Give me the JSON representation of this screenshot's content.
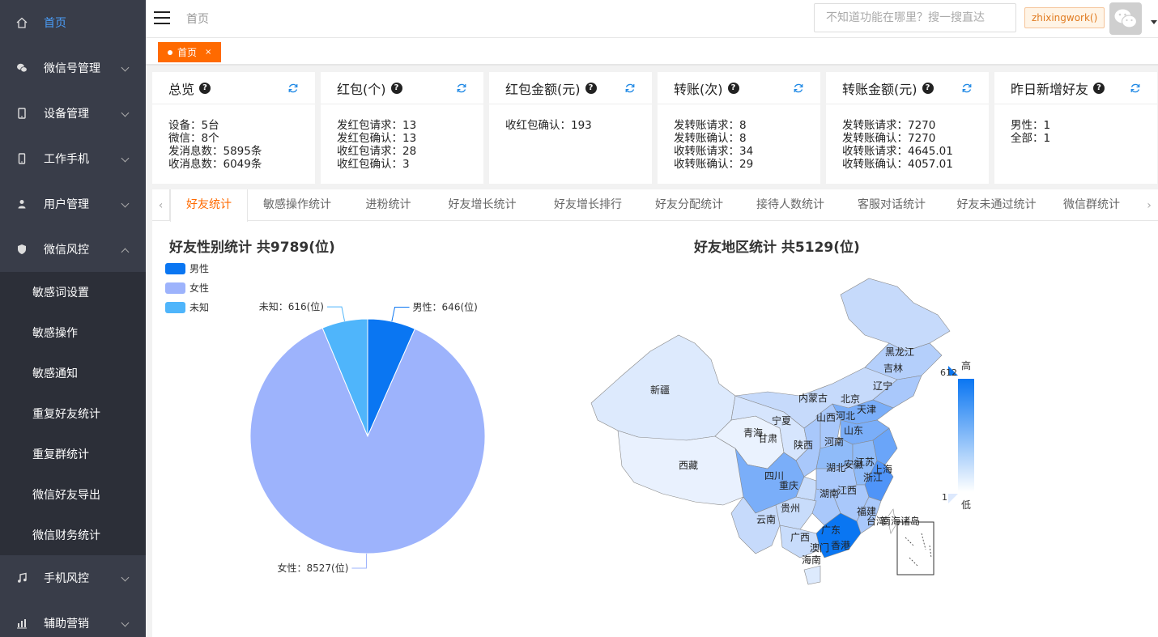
{
  "sidebar": {
    "items": [
      {
        "label": "首页",
        "icon": "home-icon"
      },
      {
        "label": "微信号管理",
        "icon": "wechat-icon"
      },
      {
        "label": "设备管理",
        "icon": "tablet-icon"
      },
      {
        "label": "工作手机",
        "icon": "phone-icon"
      },
      {
        "label": "用户管理",
        "icon": "user-icon"
      },
      {
        "label": "微信风控",
        "icon": "shield-icon"
      }
    ],
    "sub_items": [
      "敏感词设置",
      "敏感操作",
      "敏感通知",
      "重复好友统计",
      "重复群统计",
      "微信好友导出",
      "微信财务统计"
    ],
    "bottom_items": [
      {
        "label": "手机风控",
        "icon": "music-icon"
      },
      {
        "label": "辅助营销",
        "icon": "bar-chart-icon"
      }
    ]
  },
  "header": {
    "breadcrumb": "首页",
    "search_placeholder": "不知道功能在哪里？搜一搜直达",
    "username": "zhixingwork()"
  },
  "page_tab": {
    "label": "首页",
    "close": "×"
  },
  "cards": [
    {
      "title": "总览",
      "lines": [
        "设备：5台",
        "微信：8个",
        "发消息数：5895条",
        "收消息数：6049条"
      ]
    },
    {
      "title": "红包(个)",
      "lines": [
        "发红包请求：13",
        "发红包确认：13",
        "收红包请求：28",
        "收红包确认：3"
      ]
    },
    {
      "title": "红包金额(元)",
      "lines": [
        "收红包确认：193"
      ]
    },
    {
      "title": "转账(次)",
      "lines": [
        "发转账请求：8",
        "发转账确认：8",
        "收转账请求：34",
        "收转账确认：29"
      ]
    },
    {
      "title": "转账金额(元)",
      "lines": [
        "发转账请求：7270",
        "发转账确认：7270",
        "收转账请求：4645.01",
        "收转账确认：4057.01"
      ]
    },
    {
      "title": "昨日新增好友",
      "lines": [
        "男性：1",
        "全部：1"
      ]
    }
  ],
  "stat_tabs": [
    "好友统计",
    "敏感操作统计",
    "进粉统计",
    "好友增长统计",
    "好友增长排行",
    "好友分配统计",
    "接待人数统计",
    "客服对话统计",
    "好友未通过统计",
    "微信群统计"
  ],
  "active_tab": "好友统计",
  "chart_data": [
    {
      "type": "pie",
      "title": "好友性别统计 共9789(位)",
      "legend_position": "top-left",
      "slices": [
        {
          "name": "男性",
          "value": 646,
          "label": "男性：646(位)",
          "color": "#0a76f2"
        },
        {
          "name": "女性",
          "value": 8527,
          "label": "女性：8527(位)",
          "color": "#9db3fc"
        },
        {
          "name": "未知",
          "value": 616,
          "label": "未知：616(位)",
          "color": "#4fb5fb"
        }
      ]
    },
    {
      "type": "heatmap",
      "title": "好友地区统计 共5129(位)",
      "visual_map": {
        "min": 1,
        "max": 612,
        "max_label": "612",
        "min_label": "1",
        "high_text": "高",
        "low_text": "低"
      },
      "regions": [
        "新疆",
        "西藏",
        "青海",
        "甘肃",
        "宁夏",
        "内蒙古",
        "黑龙江",
        "吉林",
        "辽宁",
        "北京",
        "天津",
        "河北",
        "山西",
        "山东",
        "陕西",
        "河南",
        "四川",
        "重庆",
        "湖北",
        "安徽",
        "江苏",
        "上海",
        "浙江",
        "湖南",
        "江西",
        "贵州",
        "云南",
        "广西",
        "福建",
        "广东",
        "澳门",
        "香港",
        "海南",
        "台湾",
        "南海诸岛"
      ]
    }
  ]
}
